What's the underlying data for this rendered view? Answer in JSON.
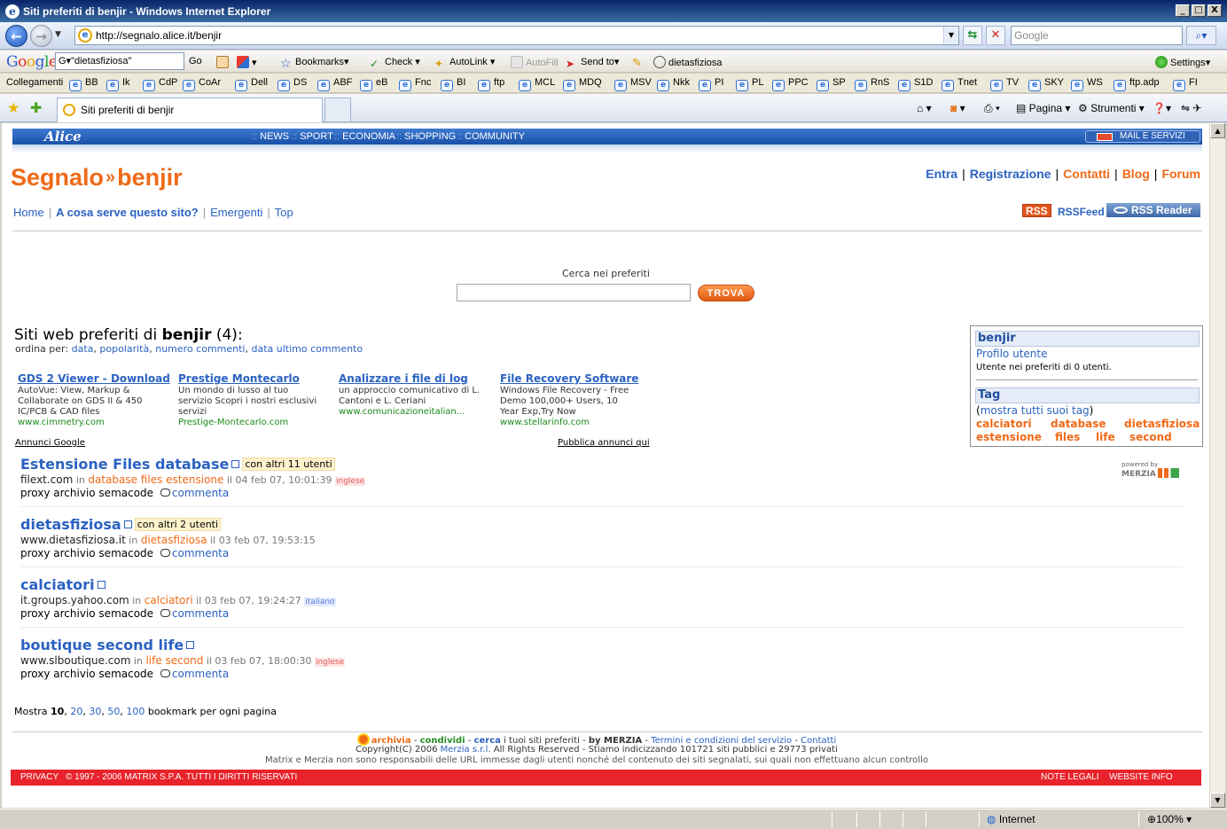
{
  "window": {
    "title": "Siti preferiti di benjir - Windows Internet Explorer",
    "controls": {
      "minimize": "_",
      "maximize": "□",
      "close": "X"
    }
  },
  "navbar": {
    "url": "http://segnalo.alice.it/benjir",
    "search_placeholder": "Google"
  },
  "google_toolbar": {
    "logo": {
      "g": "G",
      "o1": "o",
      "o2": "o",
      "g2": "g",
      "l": "l",
      "e": "e"
    },
    "search_value": "G▾\"dietasfiziosa\"",
    "go_label": "Go",
    "bookmarks_label": "Bookmarks▾",
    "check_label": "Check ▾",
    "autolink_label": "AutoLink ▾",
    "autofill_label": "AutoFill",
    "sendto_label": "Send to▾",
    "query_label": "dietasfiziosa",
    "settings_label": "Settings▾"
  },
  "links_bar": {
    "label": "Collegamenti",
    "items": [
      "BB",
      "Ik",
      "CdP",
      "CoAr",
      "Dell",
      "DS",
      "ABF",
      "eB",
      "Fnc",
      "BI",
      "ftp",
      "MCL",
      "MDQ",
      "MSV",
      "Nkk",
      "PI",
      "PL",
      "PPC",
      "SP",
      "RnS",
      "S1D",
      "Tnet",
      "TV",
      "SKY",
      "WS",
      "ftp.adp",
      "FI"
    ]
  },
  "tabs": {
    "active_label": "Siti preferiti di benjir"
  },
  "command_bar": {
    "pagina": "Pagina ▾",
    "strumenti": "Strumenti ▾"
  },
  "page": {
    "alice_logo": "Alice",
    "alice_nav": [
      "NEWS",
      "SPORT",
      "ECONOMIA",
      "SHOPPING",
      "COMMUNITY"
    ],
    "mail_servizi": "MAIL E SERVIZI",
    "logo_main": "Segnalo",
    "logo_arrows": "»",
    "logo_user": "benjir",
    "top_links": [
      "Entra",
      "Registrazione",
      "Contatti",
      "Blog",
      "Forum"
    ],
    "sub_nav": [
      "Home",
      "A cosa serve questo sito?",
      "Emergenti",
      "Top"
    ],
    "rss_badge": "RSS",
    "rss_feed": "RSSFeed",
    "rss_reader": "RSS Reader",
    "search_label": "Cerca nei preferiti",
    "search_value": "",
    "trova": "TROVA",
    "bookmarks_title_prefix": "Siti web preferiti di ",
    "bookmarks_title_user": "benjir",
    "bookmarks_title_count": " (4):",
    "sort_label": "ordina per: ",
    "sort_options": [
      "data",
      "popolarità",
      "numero commenti",
      "data ultimo commento"
    ],
    "ads": [
      {
        "title": "GDS 2 Viewer - Download",
        "lines": [
          "AutoVue: View, Markup &",
          "Collaborate on GDS II & 450",
          "IC/PCB & CAD files"
        ],
        "url": "www.cimmetry.com"
      },
      {
        "title": "Prestige Montecarlo",
        "lines": [
          "Un mondo di lusso al tuo",
          "servizio Scopri i nostri esclusivi",
          "servizi"
        ],
        "url": "Prestige-Montecarlo.com"
      },
      {
        "title": "Analizzare i file di log",
        "lines": [
          "un approccio comunicativo di L.",
          "Cantoni e L. Ceriani"
        ],
        "url": "www.comunicazioneitalian..."
      },
      {
        "title": "File Recovery Software",
        "lines": [
          "Windows File Recovery - Free",
          "Demo 100,000+ Users, 10",
          "Year Exp,Try Now"
        ],
        "url": "www.stellarinfo.com"
      }
    ],
    "annunci_google": "Annunci Google",
    "pubblica_annunci": "Pubblica annunci qui",
    "bookmarks": [
      {
        "title": "Estensione Files database",
        "others": "con altri 11 utenti",
        "domain": "filext.com",
        "in": " in ",
        "tags": "database files estensione",
        "ts": " il 04 feb 07, 10:01:39 ",
        "lang": "inglese",
        "actions": "proxy archivio semacode ",
        "comment": "commenta"
      },
      {
        "title": "dietasfiziosa",
        "others": "con altri 2 utenti",
        "domain": "www.dietasfiziosa.it",
        "in": " in ",
        "tags": "dietasfiziosa",
        "ts": " il 03 feb 07, 19:53:15",
        "lang": "",
        "actions": "proxy archivio semacode ",
        "comment": "commenta"
      },
      {
        "title": "calciatori",
        "others": "",
        "domain": "it.groups.yahoo.com",
        "in": " in ",
        "tags": "calciatori",
        "ts": " il 03 feb 07, 19:24:27 ",
        "lang": "italiano",
        "actions": "proxy archivio semacode ",
        "comment": "commenta"
      },
      {
        "title": "boutique second life",
        "others": "",
        "domain": "www.slboutique.com",
        "in": " in ",
        "tags": "life second",
        "ts": " il 03 feb 07, 18:00:30 ",
        "lang": "inglese",
        "actions": "proxy archivio semacode ",
        "comment": "commenta"
      }
    ],
    "powered_by": "powered by",
    "merzia": "MERZIA",
    "sidebox": {
      "user_head": "benjir",
      "profilo": "Profilo utente",
      "count_text": "Utente nei preferiti di 0 utenti.",
      "tag_head": "Tag",
      "mostra_open": "(",
      "mostra_link": "mostra tutti suoi tag",
      "mostra_close": ")",
      "tags": [
        "calciatori",
        "database",
        "dietasfiziosa",
        "estensione",
        "files",
        "life",
        "second"
      ]
    },
    "per_page": {
      "prefix": "Mostra ",
      "current": "10",
      "options": [
        "20",
        "30",
        "50",
        "100"
      ],
      "suffix": " bookmark per ogni pagina"
    },
    "footer": {
      "archivia": "archivia",
      "condividi": "condividi",
      "cerca": "cerca",
      "tagline": " i tuoi siti preferiti - ",
      "bymerzia": "by MERZIA",
      "terms": "Termini e condizioni del servizio",
      "contatti": "Contatti",
      "copy_prefix": "Copyright(C) 2006 ",
      "copy_link": "Merzia s.r.l.",
      "copy_suffix": " All Rights Reserved - Stiamo indicizzando 101721 siti pubblici e 29773 privati",
      "disclaimer": "Matrix e Merzia non sono responsabili delle URL immesse dagli utenti nonché del contenuto dei siti segnalati, sui quali non effettuano alcun controllo",
      "privacy": "PRIVACY",
      "copyright_matrix": "© 1997 - 2006 MATRIX S.P.A. TUTTI I DIRITTI RISERVATI",
      "note_legali": "NOTE LEGALI",
      "website_info": "WEBSITE INFO"
    }
  },
  "statusbar": {
    "zone": "Internet",
    "zoom": "100%"
  },
  "colors": {
    "accent_orange": "#ef6a17",
    "link_blue": "#2b62c2",
    "alice_blue": "#1a50a8",
    "footer_red": "#e8232b"
  }
}
